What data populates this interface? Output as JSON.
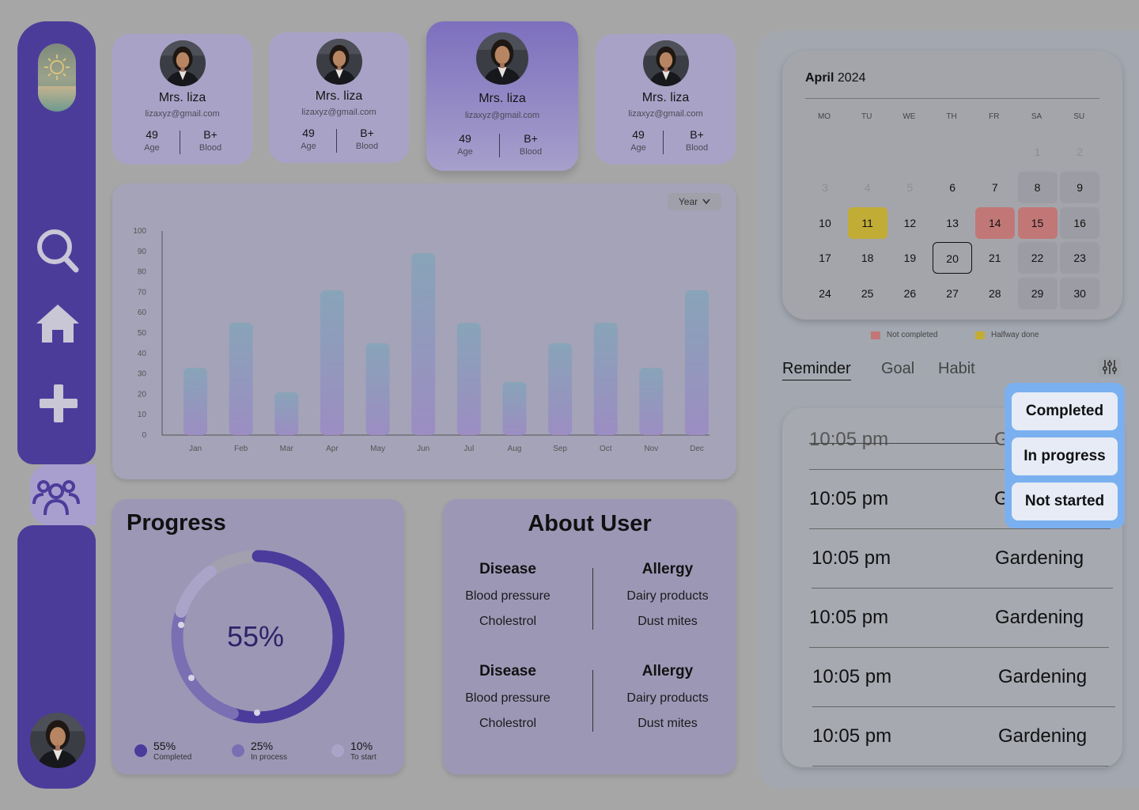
{
  "sidebar": {
    "items": [
      {
        "name": "search"
      },
      {
        "name": "home"
      },
      {
        "name": "add"
      },
      {
        "name": "users",
        "active": true
      }
    ]
  },
  "profiles": [
    {
      "name": "Mrs. liza",
      "email": "lizaxyz@gmail.com",
      "age": "49",
      "age_label": "Age",
      "blood": "B+",
      "blood_label": "Blood"
    },
    {
      "name": "Mrs. liza",
      "email": "lizaxyz@gmail.com",
      "age": "49",
      "age_label": "Age",
      "blood": "B+",
      "blood_label": "Blood"
    },
    {
      "name": "Mrs. liza",
      "email": "lizaxyz@gmail.com",
      "age": "49",
      "age_label": "Age",
      "blood": "B+",
      "blood_label": "Blood",
      "selected": true
    },
    {
      "name": "Mrs. liza",
      "email": "lizaxyz@gmail.com",
      "age": "49",
      "age_label": "Age",
      "blood": "B+",
      "blood_label": "Blood"
    }
  ],
  "chart_controls": {
    "period": "Year"
  },
  "chart_data": {
    "type": "bar",
    "categories": [
      "Jan",
      "Feb",
      "Mar",
      "Apr",
      "May",
      "Jun",
      "Jul",
      "Aug",
      "Sep",
      "Oct",
      "Nov",
      "Dec"
    ],
    "values": [
      33,
      55,
      21,
      71,
      45,
      89,
      55,
      26,
      45,
      55,
      33,
      71
    ],
    "yticks": [
      0,
      10,
      20,
      30,
      40,
      50,
      60,
      70,
      80,
      90,
      100
    ],
    "ylim": [
      0,
      100
    ],
    "title": "",
    "xlabel": "",
    "ylabel": "",
    "grid": false,
    "colors": {
      "top": "#88a4b8",
      "bottom": "#9c8dc2"
    }
  },
  "progress": {
    "title": "Progress",
    "center_label": "55%",
    "segments": [
      {
        "value": "55%",
        "label": "Completed",
        "fraction": 0.55,
        "color": "#4b3b9b"
      },
      {
        "value": "25%",
        "label": "In process",
        "fraction": 0.25,
        "color": "#7a6fb3"
      },
      {
        "value": "10%",
        "label": "To start",
        "fraction": 0.1,
        "color": "#aaa5c8"
      }
    ]
  },
  "about": {
    "title": "About User",
    "groups": [
      {
        "disease_h": "Disease",
        "diseases": [
          "Blood pressure",
          "Cholestrol"
        ],
        "allergy_h": "Allergy",
        "allergies": [
          "Dairy products",
          "Dust mites"
        ]
      },
      {
        "disease_h": "Disease",
        "diseases": [
          "Blood pressure",
          "Cholestrol"
        ],
        "allergy_h": "Allergy",
        "allergies": [
          "Dairy products",
          "Dust mites"
        ]
      }
    ]
  },
  "calendar": {
    "month": "April",
    "year": "2024",
    "weekdays": [
      "MO",
      "TU",
      "WE",
      "TH",
      "FR",
      "SA",
      "SU"
    ],
    "rows": [
      [
        null,
        null,
        null,
        null,
        null,
        "1",
        "2"
      ],
      [
        "3",
        "4",
        "5",
        "6",
        "7",
        "8",
        "9"
      ],
      [
        "10",
        "11",
        "12",
        "13",
        "14",
        "15",
        "16"
      ],
      [
        "17",
        "18",
        "19",
        "20",
        "21",
        "22",
        "23"
      ],
      [
        "24",
        "25",
        "26",
        "27",
        "28",
        "29",
        "30"
      ]
    ],
    "muted": [
      "1",
      "2",
      "3",
      "4",
      "5"
    ],
    "halfway": [
      "11"
    ],
    "not_completed": [
      "14",
      "15"
    ],
    "today": "20",
    "legend": [
      {
        "label": "Not completed",
        "color": "#c27777"
      },
      {
        "label": "Halfway done",
        "color": "#c1ad36"
      }
    ]
  },
  "tabs": [
    {
      "label": "Reminder",
      "active": true
    },
    {
      "label": "Goal"
    },
    {
      "label": "Habit"
    }
  ],
  "reminders": [
    {
      "time": "10:05 pm",
      "activity": "G",
      "done": true
    },
    {
      "time": "10:05 pm",
      "activity": "G"
    },
    {
      "time": "10:05 pm",
      "activity": "Gardening"
    },
    {
      "time": "10:05 pm",
      "activity": "Gardening"
    },
    {
      "time": "10:05 pm",
      "activity": "Gardening"
    },
    {
      "time": "10:05 pm",
      "activity": "Gardening"
    }
  ],
  "status_menu": {
    "options": [
      "Completed",
      "In progress",
      "Not started"
    ]
  }
}
